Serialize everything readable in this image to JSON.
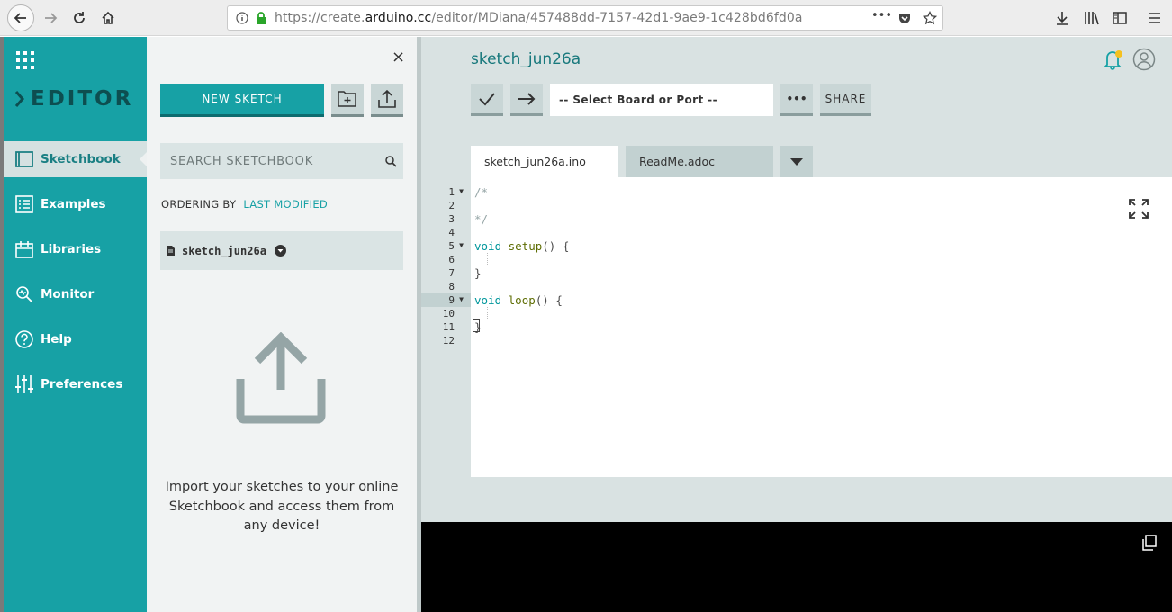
{
  "browser": {
    "url_prefix": "https://create.",
    "url_domain": "arduino.cc",
    "url_path": "/editor/MDiana/457488dd-7157-42d1-9ae9-1c428bd6fd0a",
    "url_more": "•••"
  },
  "nav": {
    "brand": "EDITOR",
    "items": [
      {
        "label": "Sketchbook",
        "icon": "folder-icon"
      },
      {
        "label": "Examples",
        "icon": "list-icon"
      },
      {
        "label": "Libraries",
        "icon": "library-icon"
      },
      {
        "label": "Monitor",
        "icon": "monitor-icon"
      },
      {
        "label": "Help",
        "icon": "help-icon"
      },
      {
        "label": "Preferences",
        "icon": "sliders-icon"
      }
    ],
    "accent_color": "#17a1a5"
  },
  "sketchbook": {
    "close_symbol": "×",
    "new_sketch_label": "NEW SKETCH",
    "search_placeholder": "SEARCH SKETCHBOOK",
    "ordering_label": "ORDERING BY",
    "ordering_value": "LAST MODIFIED",
    "sketch_item": "sketch_jun26a",
    "import_message": "Import your sketches to your online Sketchbook and access them from any device!"
  },
  "editor": {
    "sketch_title": "sketch_jun26a",
    "board_select": "-- Select Board or Port --",
    "more_label": "•••",
    "share_label": "SHARE",
    "tabs": [
      {
        "label": "sketch_jun26a.ino",
        "active": true
      },
      {
        "label": "ReadMe.adoc",
        "active": false
      }
    ],
    "line_numbers": [
      "1",
      "2",
      "3",
      "4",
      "5",
      "6",
      "7",
      "8",
      "9",
      "10",
      "11",
      "12"
    ],
    "code": {
      "l1": "/*",
      "l3": "*/",
      "kw_void": "void",
      "fn_setup": "setup",
      "fn_loop": "loop",
      "paren_brace": "() {",
      "close_brace": "}"
    }
  }
}
